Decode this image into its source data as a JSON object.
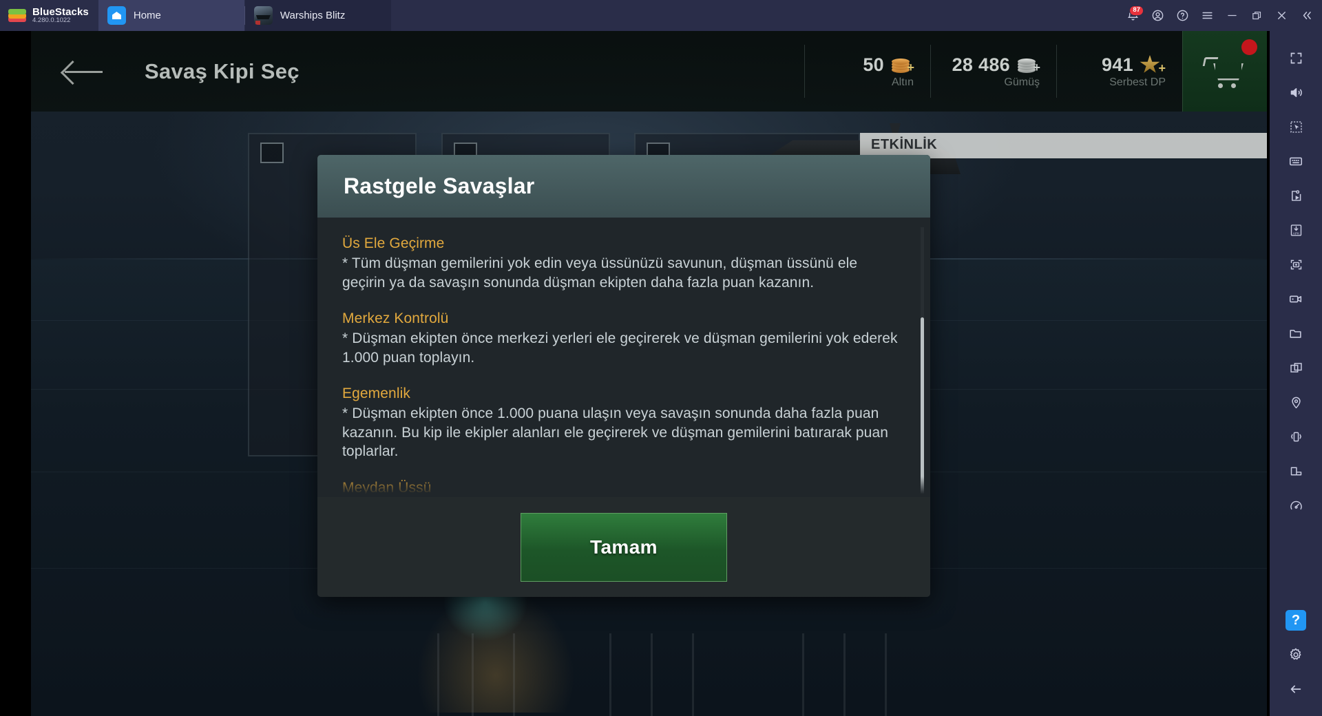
{
  "titlebar": {
    "brand": "BlueStacks",
    "version": "4.280.0.1022",
    "tabs": [
      {
        "label": "Home",
        "icon": "home-icon",
        "active": true
      },
      {
        "label": "Warships Blitz",
        "icon": "game-thumbnail-icon",
        "active": false
      }
    ],
    "notification_count": "87",
    "icons": [
      "notifications-bell-icon",
      "account-icon",
      "help-circle-icon",
      "hamburger-menu-icon",
      "minimize-icon",
      "maximize-icon",
      "close-icon",
      "collapse-chevrons-icon"
    ]
  },
  "game": {
    "header": {
      "back_icon": "back-arrow-icon",
      "title": "Savaş Kipi Seç",
      "currencies": [
        {
          "value": "50",
          "label": "Altın",
          "icon": "gold-coins-icon"
        },
        {
          "value": "28 486",
          "label": "Gümüş",
          "icon": "silver-coins-icon"
        },
        {
          "value": "941",
          "label": "Serbest DP",
          "icon": "star-icon"
        }
      ],
      "cart_icon": "shopping-cart-icon"
    },
    "background": {
      "event_badge": "ETKİNLİK"
    }
  },
  "modal": {
    "title": "Rastgele Savaşlar",
    "sections": [
      {
        "heading": "Üs Ele Geçirme",
        "text": "* Tüm düşman gemilerini yok edin veya üssünüzü savunun, düşman üssünü ele geçirin ya da savaşın sonunda düşman ekipten daha fazla puan kazanın."
      },
      {
        "heading": "Merkez Kontrolü",
        "text": "* Düşman ekipten önce merkezi yerleri ele geçirerek ve düşman gemilerini yok ederek 1.000 puan toplayın."
      },
      {
        "heading": "Egemenlik",
        "text": "* Düşman ekipten önce 1.000 puana ulaşın veya savaşın sonunda daha fazla puan kazanın. Bu kip ile ekipler alanları ele geçirerek ve düşman gemilerini batırarak puan toplarlar."
      },
      {
        "heading": "Meydan Üssü",
        "text": ""
      }
    ],
    "ok_label": "Tamam"
  },
  "sidebar": {
    "items": [
      "fullscreen-icon",
      "volume-icon",
      "pointer-select-icon",
      "keyboard-controls-icon",
      "macro-script-icon",
      "install-apk-icon",
      "screenshot-icon",
      "record-video-icon",
      "media-folder-icon",
      "multi-instance-icon",
      "location-pin-icon",
      "shake-device-icon",
      "rotate-screen-icon",
      "performance-meter-icon"
    ],
    "bottom": [
      "help-badge-icon",
      "settings-gear-icon",
      "back-arrow-icon"
    ],
    "help_label": "?"
  }
}
